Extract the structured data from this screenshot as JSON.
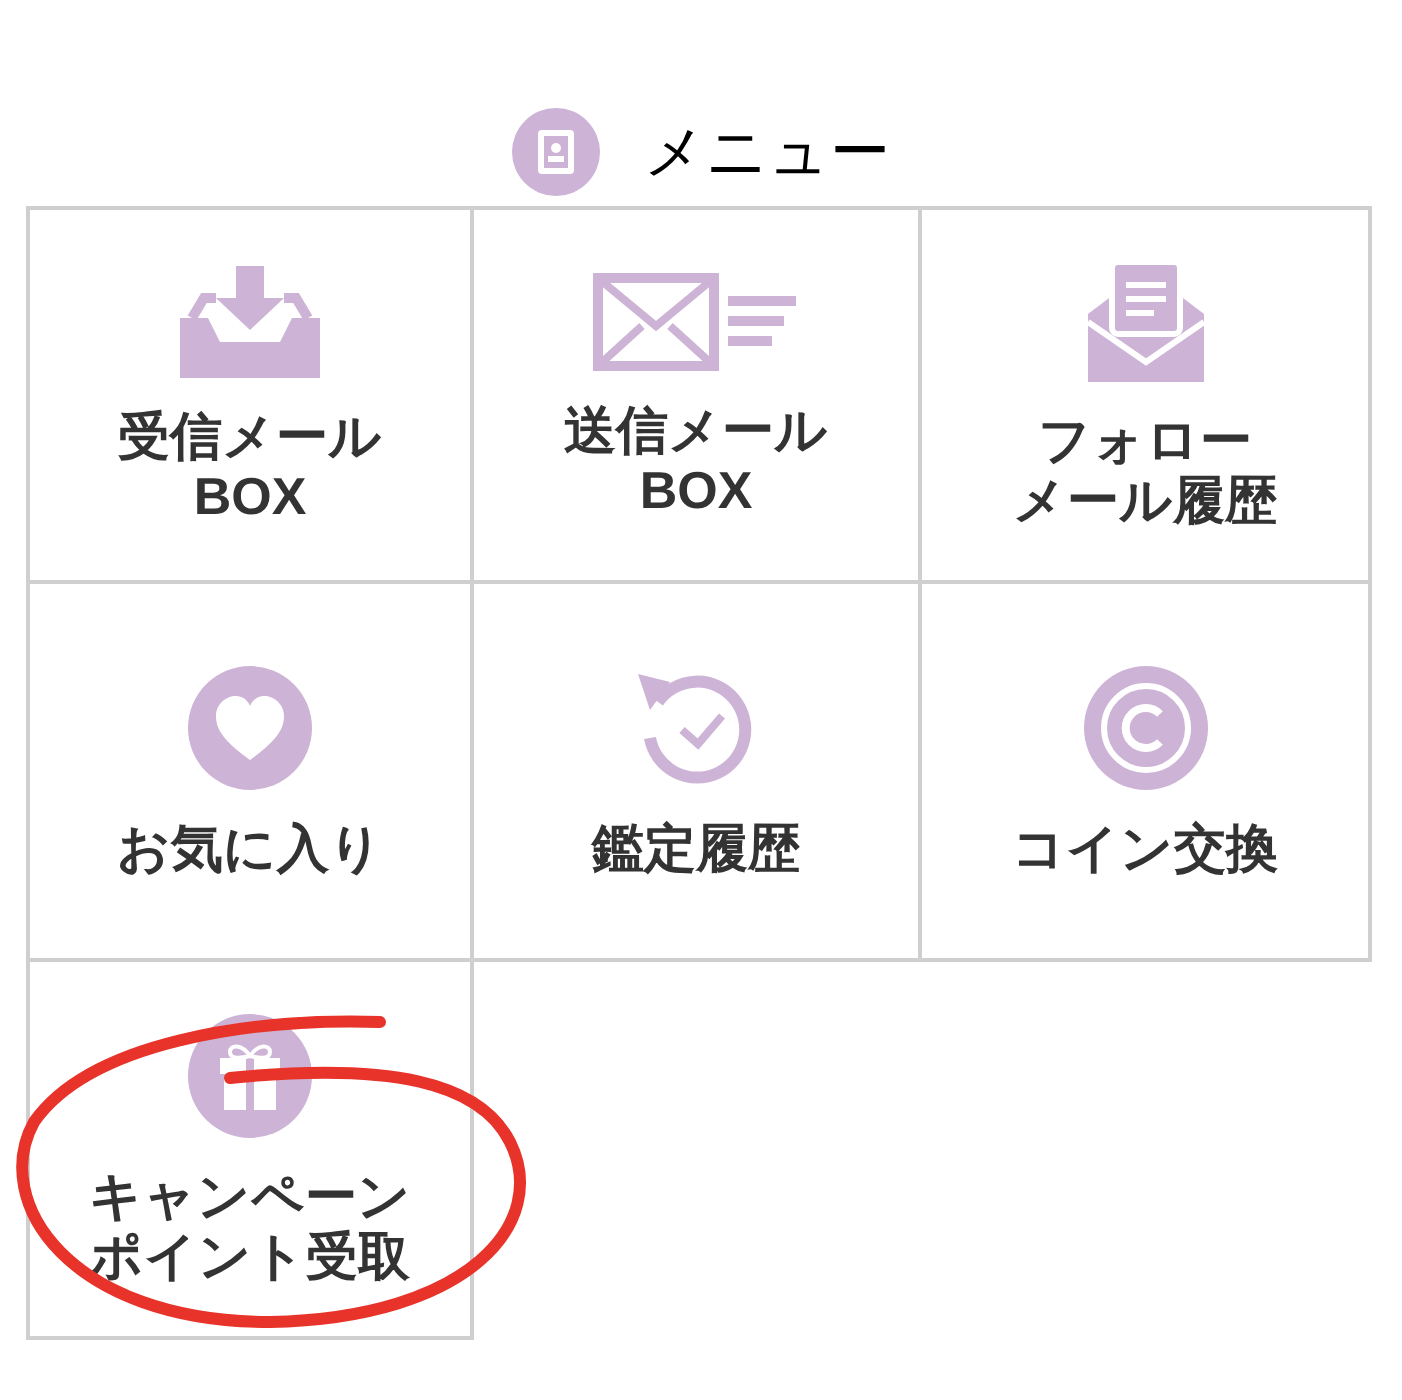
{
  "header": {
    "title": "メニュー"
  },
  "menu_items": [
    {
      "kind": "inbox",
      "label_lines": [
        "受信メール",
        "BOX"
      ],
      "highlighted": false
    },
    {
      "kind": "send",
      "label_lines": [
        "送信メール",
        "BOX"
      ],
      "highlighted": false
    },
    {
      "kind": "open-mail",
      "label_lines": [
        "フォロー",
        "メール履歴"
      ],
      "highlighted": false
    },
    {
      "kind": "heart",
      "label_lines": [
        "お気に入り"
      ],
      "highlighted": false
    },
    {
      "kind": "history",
      "label_lines": [
        "鑑定履歴"
      ],
      "highlighted": false
    },
    {
      "kind": "coin",
      "label_lines": [
        "コイン交換"
      ],
      "highlighted": false
    },
    {
      "kind": "gift",
      "label_lines": [
        "キャンペーン",
        "ポイント受取"
      ],
      "highlighted": true
    }
  ]
}
